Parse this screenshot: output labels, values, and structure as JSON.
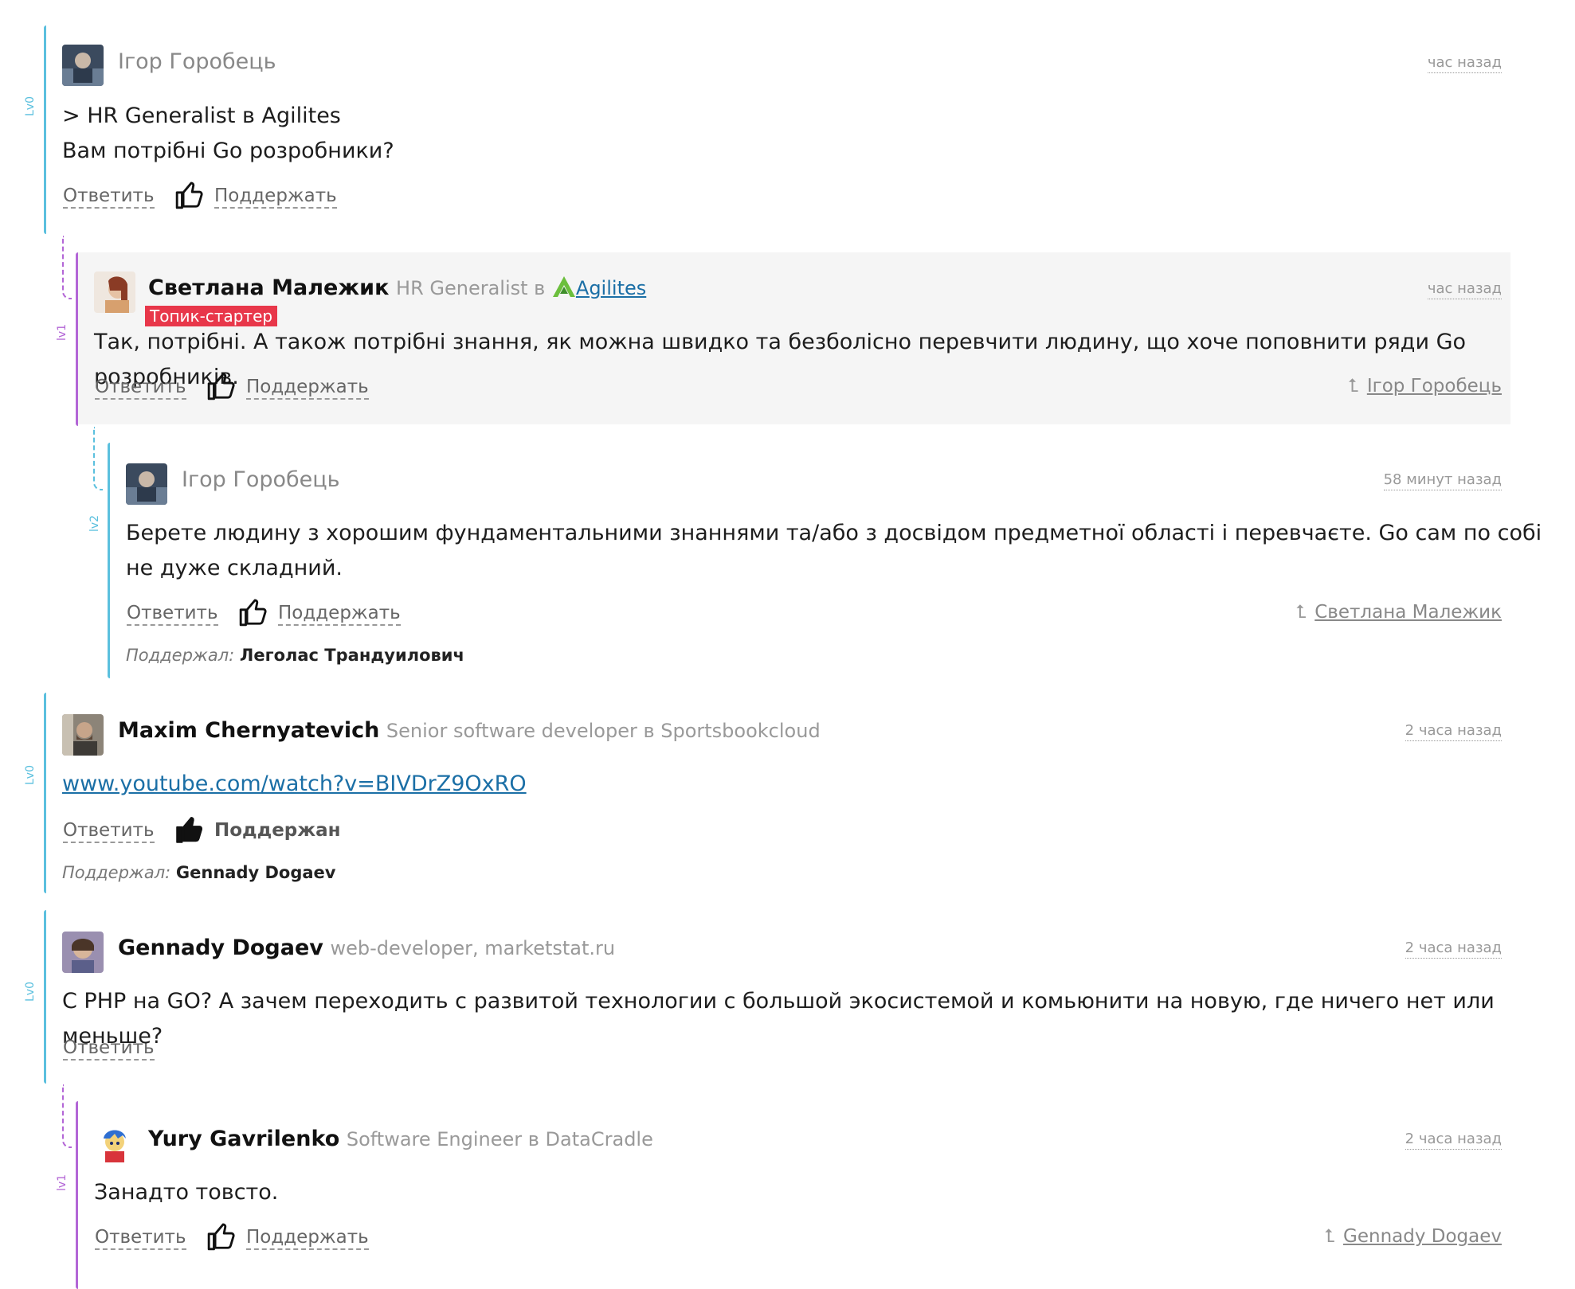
{
  "colors": {
    "lv0": "#5bc0de",
    "lv1": "#b366d6",
    "lv2": "#5bc0de",
    "badge": "#e8374a",
    "link": "#1b6fa6"
  },
  "common": {
    "reply_label": "Ответить",
    "support_label": "Поддержать",
    "supported_label": "Поддержан",
    "likers_label": "Поддержал:"
  },
  "comments": [
    {
      "level": "Lv0",
      "author": "Ігор Горобець",
      "position": "",
      "time": "час назад",
      "lines": [
        "> HR Generalist в Agilites",
        "Вам потрібні Go розробники?"
      ]
    },
    {
      "level": "lv1",
      "author": "Светлана Малежик",
      "position": "HR Generalist в",
      "company": "Agilites",
      "badge": "Топик-стартер",
      "time": "час назад",
      "lines": [
        "Так, потрібні. А також потрібні знання, як можна швидко та безболісно перевчити людину, що хоче поповнити ряди Go розробників."
      ],
      "parent": "Ігор Горобець"
    },
    {
      "level": "lv2",
      "author": "Ігор Горобець",
      "time": "58 минут назад",
      "lines": [
        "Берете людину з хорошим фундаментальними знаннями та/або з досвідом предметної області і перевчаєте. Go сам по собі",
        "не дуже складний."
      ],
      "parent": "Светлана Малежик",
      "likers": "Леголас Трандуилович"
    },
    {
      "level": "Lv0",
      "author": "Maxim Chernyatevich",
      "position": "Senior software developer в Sportsbookcloud",
      "time": "2 часа назад",
      "link": "www.youtube.com/watch?v=BIVDrZ9OxRO",
      "likers": "Gennady Dogaev"
    },
    {
      "level": "Lv0",
      "author": "Gennady Dogaev",
      "position": "web-developer, marketstat.ru",
      "time": "2 часа назад",
      "lines": [
        "С PHP на GO? А зачем переходить с развитой технологии с большой экосистемой и комьюнити на новую, где ничего нет или меньше?"
      ]
    },
    {
      "level": "lv1",
      "author": "Yury Gavrilenko",
      "position": "Software Engineer в DataCradle",
      "time": "2 часа назад",
      "lines": [
        "Занадто товсто."
      ],
      "parent": "Gennady Dogaev"
    }
  ]
}
